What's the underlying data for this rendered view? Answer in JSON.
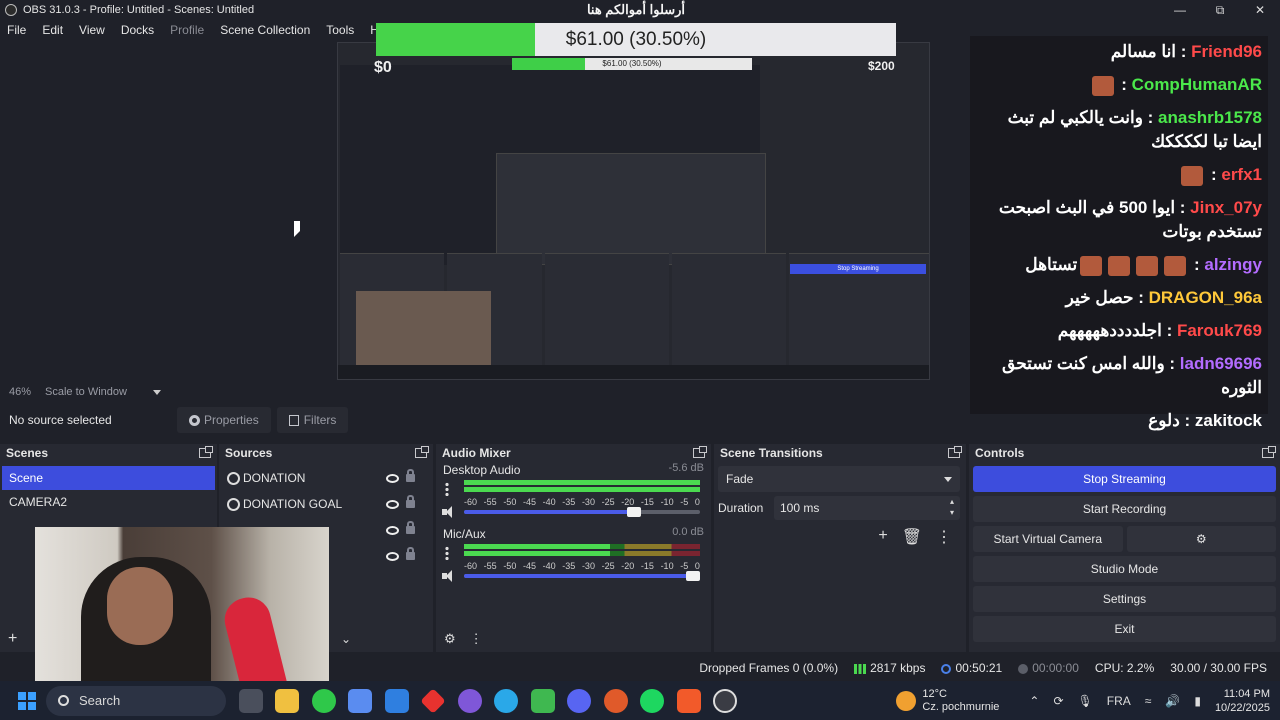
{
  "window": {
    "title": "OBS 31.0.3 - Profile: Untitled - Scenes: Untitled"
  },
  "menu": [
    "File",
    "Edit",
    "View",
    "Docks",
    "Profile",
    "Scene Collection",
    "Tools",
    "Help"
  ],
  "donation": {
    "label": "أرسلوا أموالكم هنا",
    "amount_text": "$61.00 (30.50%)",
    "progress_percent": 30.5,
    "left_value": "$0",
    "right_value": "$200"
  },
  "chat": [
    {
      "user": "Friend96",
      "user_color": "#ff4a4a",
      "message": "انا مسالم",
      "emotes": 0
    },
    {
      "user": "CompHumanAR",
      "user_color": "#4be84b",
      "message": "",
      "emotes": 1
    },
    {
      "user": "anashrb1578",
      "user_color": "#4be84b",
      "message": "وانت يالكبي لم تبث ايضا تبا لككككك",
      "emotes": 0
    },
    {
      "user": "erfx1",
      "user_color": "#ff4a4a",
      "message": "",
      "emotes": 1
    },
    {
      "user": "Jinx_07y",
      "user_color": "#ff4a4a",
      "message": "ايوا 500 في البث اصبحت تستخدم بوتات",
      "emotes": 0
    },
    {
      "user": "alzingy",
      "user_color": "#b36cff",
      "message": "تستاهل",
      "emotes": 4
    },
    {
      "user": "DRAGON_96a",
      "user_color": "#ffc83a",
      "message": "حصل خير",
      "emotes": 0
    },
    {
      "user": "Farouk769",
      "user_color": "#ff4a4a",
      "message": "اجلددددهههههم",
      "emotes": 0
    },
    {
      "user": "ladn69696",
      "user_color": "#b36cff",
      "message": "والله امس كنت تستحق الثوره",
      "emotes": 0
    },
    {
      "user": "zakitock",
      "user_color": "#ffffff",
      "message": "دلوع",
      "emotes": 0
    }
  ],
  "preview": {
    "zoom": "46%",
    "scale_mode": "Scale to Window"
  },
  "toolbar": {
    "no_source": "No source selected",
    "properties": "Properties",
    "filters": "Filters"
  },
  "scenes": {
    "title": "Scenes",
    "items": [
      "Scene",
      "CAMERA2"
    ]
  },
  "sources": {
    "title": "Sources",
    "items": [
      "DONATION",
      "DONATION GOAL"
    ]
  },
  "mixer": {
    "title": "Audio Mixer",
    "channels": [
      {
        "name": "Desktop Audio",
        "db": "-5.6 dB",
        "level_percent": 100,
        "volume_percent": 75
      },
      {
        "name": "Mic/Aux",
        "db": "0.0 dB",
        "level_percent": 62,
        "volume_percent": 100
      }
    ],
    "scale": [
      "-60",
      "-55",
      "-50",
      "-45",
      "-40",
      "-35",
      "-30",
      "-25",
      "-20",
      "-15",
      "-10",
      "-5",
      "0"
    ]
  },
  "transitions": {
    "title": "Scene Transitions",
    "selected": "Fade",
    "duration_label": "Duration",
    "duration_value": "100 ms"
  },
  "controls": {
    "title": "Controls",
    "stop_streaming": "Stop Streaming",
    "start_recording": "Start Recording",
    "start_virtual_camera": "Start Virtual Camera",
    "studio_mode": "Studio Mode",
    "settings": "Settings",
    "exit": "Exit"
  },
  "status": {
    "dropped_frames": "Dropped Frames 0 (0.0%)",
    "bitrate": "2817 kbps",
    "stream_time": "00:50:21",
    "rec_time": "00:00:00",
    "cpu": "CPU: 2.2%",
    "fps": "30.00 / 30.00 FPS"
  },
  "taskbar": {
    "search": "Search",
    "weather_temp": "12°C",
    "weather_desc": "Cz. pochmurnie",
    "language": "FRA",
    "time": "11:04 PM",
    "date": "10/22/2025"
  }
}
